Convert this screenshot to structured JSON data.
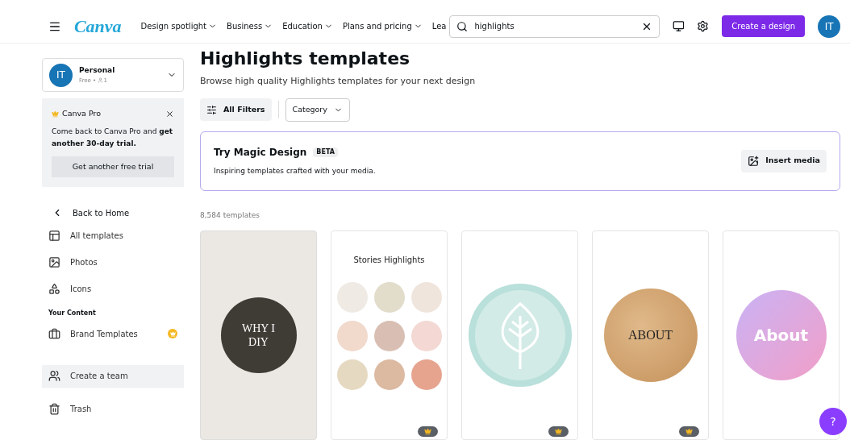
{
  "nav": {
    "logo": "Canva",
    "menu": [
      "Design spotlight",
      "Business",
      "Education",
      "Plans and pricing",
      "Lea"
    ],
    "search": {
      "value": "highlights"
    },
    "create_button": "Create a design",
    "avatar": "IT"
  },
  "sidebar": {
    "account": {
      "avatar": "IT",
      "name": "Personal",
      "plan": "Free • ",
      "members": "1"
    },
    "promo": {
      "title": "Canva Pro",
      "text": "Come back to Canva Pro and **get another 30-day trial.**",
      "button": "Get another free trial"
    },
    "back": "Back to Home",
    "items": [
      {
        "label": "All templates"
      },
      {
        "label": "Photos"
      },
      {
        "label": "Icons"
      }
    ],
    "section": "Your Content",
    "content_items": [
      {
        "label": "Brand Templates",
        "premium": true
      }
    ],
    "bottom_items": [
      {
        "label": "Create a team",
        "selected": true
      },
      {
        "label": "Trash",
        "selected": false
      }
    ]
  },
  "main": {
    "title": "Highlights templates",
    "subtitle": "Browse high quality Highlights templates for your next design",
    "filters": "All Filters",
    "category": "Category",
    "magic": {
      "title": "Try Magic Design",
      "badge": "BETA",
      "text": "Inspiring templates crafted with your media.",
      "button": "Insert media"
    },
    "count": "8,584 templates",
    "templates": [
      {
        "kind": "dark-circle",
        "text": "WHY I DIY",
        "premium": false
      },
      {
        "kind": "grid",
        "title": "Stories Highlights",
        "premium": true
      },
      {
        "kind": "leaf",
        "premium": true
      },
      {
        "kind": "gold",
        "text": "ABOUT",
        "premium": true
      },
      {
        "kind": "gradient",
        "text": "About",
        "premium": false
      }
    ]
  },
  "help": "?"
}
